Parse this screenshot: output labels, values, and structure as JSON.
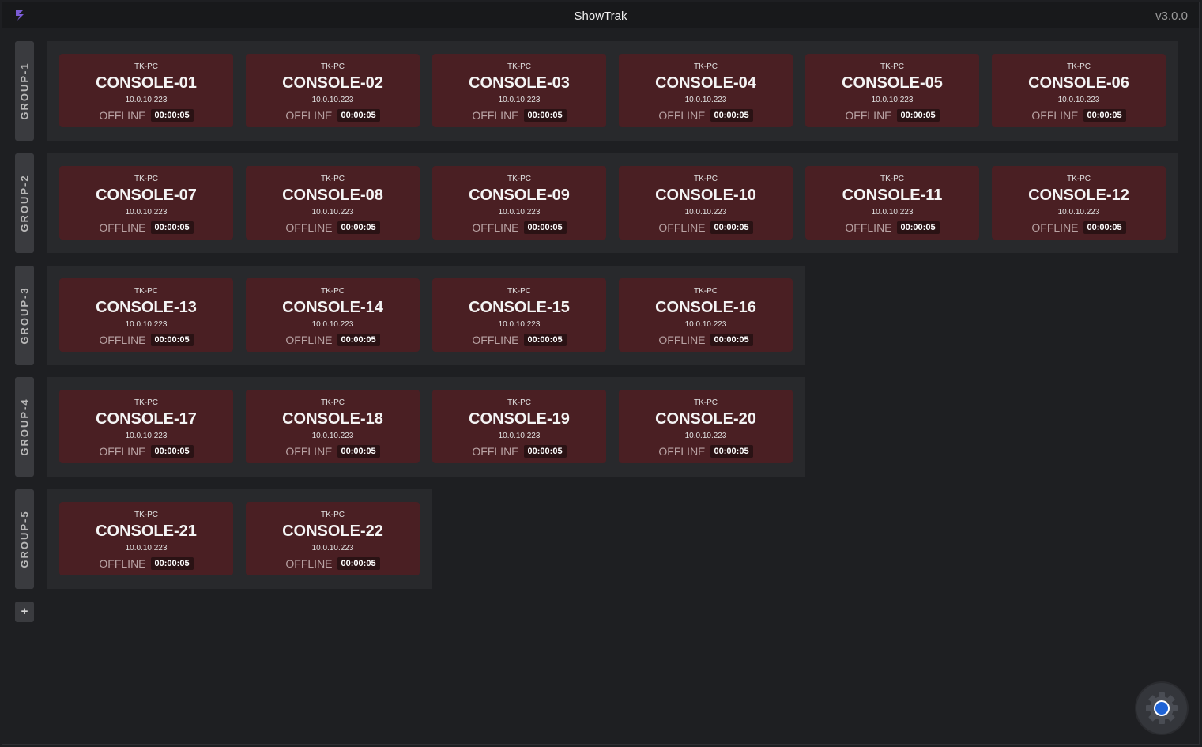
{
  "window": {
    "title": "ShowTrak",
    "version": "v3.0.0"
  },
  "groups": [
    {
      "label": "GROUP-1",
      "cards": [
        {
          "host": "TK-PC",
          "name": "CONSOLE-01",
          "ip": "10.0.10.223",
          "status": "OFFLINE",
          "timer": "00:00:05"
        },
        {
          "host": "TK-PC",
          "name": "CONSOLE-02",
          "ip": "10.0.10.223",
          "status": "OFFLINE",
          "timer": "00:00:05"
        },
        {
          "host": "TK-PC",
          "name": "CONSOLE-03",
          "ip": "10.0.10.223",
          "status": "OFFLINE",
          "timer": "00:00:05"
        },
        {
          "host": "TK-PC",
          "name": "CONSOLE-04",
          "ip": "10.0.10.223",
          "status": "OFFLINE",
          "timer": "00:00:05"
        },
        {
          "host": "TK-PC",
          "name": "CONSOLE-05",
          "ip": "10.0.10.223",
          "status": "OFFLINE",
          "timer": "00:00:05"
        },
        {
          "host": "TK-PC",
          "name": "CONSOLE-06",
          "ip": "10.0.10.223",
          "status": "OFFLINE",
          "timer": "00:00:05"
        }
      ]
    },
    {
      "label": "GROUP-2",
      "cards": [
        {
          "host": "TK-PC",
          "name": "CONSOLE-07",
          "ip": "10.0.10.223",
          "status": "OFFLINE",
          "timer": "00:00:05"
        },
        {
          "host": "TK-PC",
          "name": "CONSOLE-08",
          "ip": "10.0.10.223",
          "status": "OFFLINE",
          "timer": "00:00:05"
        },
        {
          "host": "TK-PC",
          "name": "CONSOLE-09",
          "ip": "10.0.10.223",
          "status": "OFFLINE",
          "timer": "00:00:05"
        },
        {
          "host": "TK-PC",
          "name": "CONSOLE-10",
          "ip": "10.0.10.223",
          "status": "OFFLINE",
          "timer": "00:00:05"
        },
        {
          "host": "TK-PC",
          "name": "CONSOLE-11",
          "ip": "10.0.10.223",
          "status": "OFFLINE",
          "timer": "00:00:05"
        },
        {
          "host": "TK-PC",
          "name": "CONSOLE-12",
          "ip": "10.0.10.223",
          "status": "OFFLINE",
          "timer": "00:00:05"
        }
      ]
    },
    {
      "label": "GROUP-3",
      "cards": [
        {
          "host": "TK-PC",
          "name": "CONSOLE-13",
          "ip": "10.0.10.223",
          "status": "OFFLINE",
          "timer": "00:00:05"
        },
        {
          "host": "TK-PC",
          "name": "CONSOLE-14",
          "ip": "10.0.10.223",
          "status": "OFFLINE",
          "timer": "00:00:05"
        },
        {
          "host": "TK-PC",
          "name": "CONSOLE-15",
          "ip": "10.0.10.223",
          "status": "OFFLINE",
          "timer": "00:00:05"
        },
        {
          "host": "TK-PC",
          "name": "CONSOLE-16",
          "ip": "10.0.10.223",
          "status": "OFFLINE",
          "timer": "00:00:05"
        }
      ]
    },
    {
      "label": "GROUP-4",
      "cards": [
        {
          "host": "TK-PC",
          "name": "CONSOLE-17",
          "ip": "10.0.10.223",
          "status": "OFFLINE",
          "timer": "00:00:05"
        },
        {
          "host": "TK-PC",
          "name": "CONSOLE-18",
          "ip": "10.0.10.223",
          "status": "OFFLINE",
          "timer": "00:00:05"
        },
        {
          "host": "TK-PC",
          "name": "CONSOLE-19",
          "ip": "10.0.10.223",
          "status": "OFFLINE",
          "timer": "00:00:05"
        },
        {
          "host": "TK-PC",
          "name": "CONSOLE-20",
          "ip": "10.0.10.223",
          "status": "OFFLINE",
          "timer": "00:00:05"
        }
      ]
    },
    {
      "label": "GROUP-5",
      "cards": [
        {
          "host": "TK-PC",
          "name": "CONSOLE-21",
          "ip": "10.0.10.223",
          "status": "OFFLINE",
          "timer": "00:00:05"
        },
        {
          "host": "TK-PC",
          "name": "CONSOLE-22",
          "ip": "10.0.10.223",
          "status": "OFFLINE",
          "timer": "00:00:05"
        }
      ]
    }
  ],
  "add_group_label": "+",
  "icons": {
    "app": "showtrak-logo-icon",
    "settings": "gear-icon"
  },
  "colors": {
    "offline_card": "#4a1f23",
    "accent": "#1e63d6",
    "logo": "#7b5cd6"
  }
}
